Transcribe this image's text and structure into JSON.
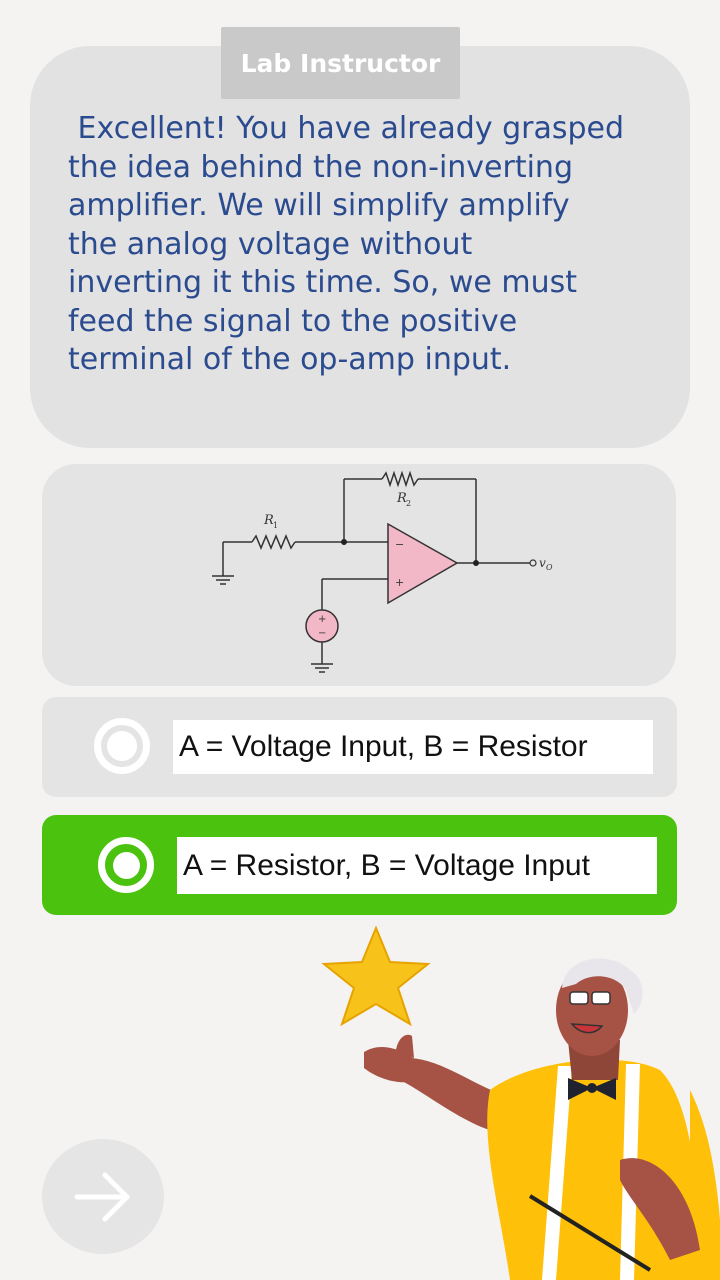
{
  "speaker": {
    "name": "Lab Instructor"
  },
  "message": {
    "text": " Excellent! You have already grasped\nthe idea behind the non-inverting\namplifier. We will simplify amplify\nthe analog voltage without\ninverting it this time. So, we must\nfeed the signal to the positive\nterminal of the op-amp input."
  },
  "circuit": {
    "r1_label": "R",
    "r1_sub": "1",
    "r2_label": "R",
    "r2_sub": "2",
    "minus_label": "−",
    "plus_label": "+",
    "source_plus": "+",
    "source_minus": "−",
    "output_label": "v",
    "output_sub": "O"
  },
  "options": [
    {
      "label": "A = Voltage Input, B = Resistor",
      "selected": false
    },
    {
      "label": "A = Resistor, B = Voltage Input",
      "selected": true
    }
  ],
  "colors": {
    "correct": "#4bc20d",
    "text": "#2b4b8f",
    "opamp": "#f2b8c8"
  },
  "icons": {
    "next": "arrow-right-icon",
    "star": "star-icon"
  }
}
